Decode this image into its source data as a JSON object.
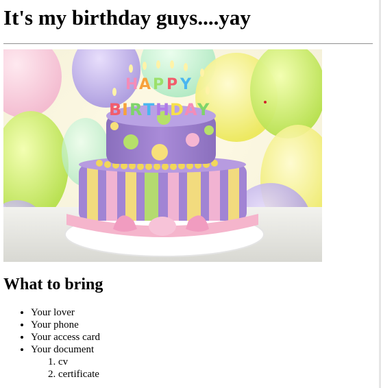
{
  "page": {
    "title": "It's my birthday guys....yay",
    "image": {
      "cake_text_line1": "HAPPY",
      "cake_text_line2": "BIRTHDAY"
    },
    "section_heading": "What to bring",
    "bring_list": [
      "Your lover",
      "Your phone",
      "Your access card",
      "Your document"
    ],
    "document_items": [
      "cv",
      "certificate"
    ]
  },
  "colors": {
    "cake_purple": "#9b7fc9",
    "frosting_pink": "#f4b8d0",
    "candle_letters": [
      "#f25c6b",
      "#f7a23b",
      "#f7e04a",
      "#7fd46a",
      "#4ab6f0",
      "#b07ae8"
    ],
    "background_balloons": [
      "#d9f26b",
      "#f2f27a",
      "#b8a8e8",
      "#f8c8dd"
    ]
  }
}
